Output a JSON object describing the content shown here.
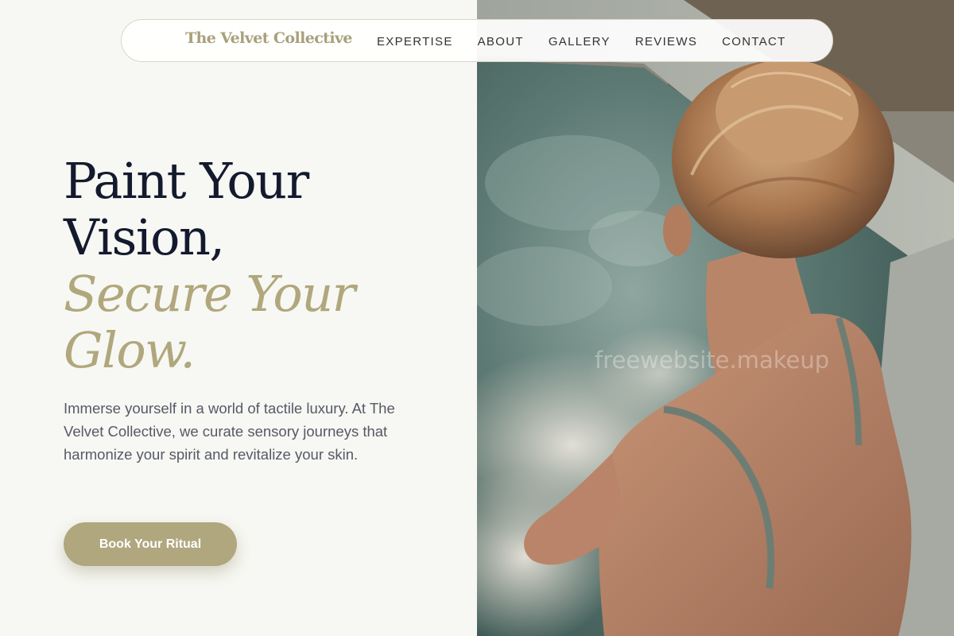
{
  "nav": {
    "brand": "The Velvet Collective",
    "links": [
      "EXPERTISE",
      "ABOUT",
      "GALLERY",
      "REVIEWS",
      "CONTACT"
    ]
  },
  "hero": {
    "headline_line1": "Paint Your",
    "headline_line2": "Vision,",
    "headline_accent_line1": "Secure Your",
    "headline_accent_line2": "Glow.",
    "body": "Immerse yourself in a world of tactile luxury. At The Velvet Collective, we curate sensory journeys that harmonize your spirit and revitalize your skin.",
    "cta_label": "Book Your Ritual"
  },
  "watermark": "freewebsite.makeup",
  "colors": {
    "accent": "#b0a77d",
    "heading": "#141a2e",
    "body": "#555a66",
    "background": "#f7f7f3"
  }
}
